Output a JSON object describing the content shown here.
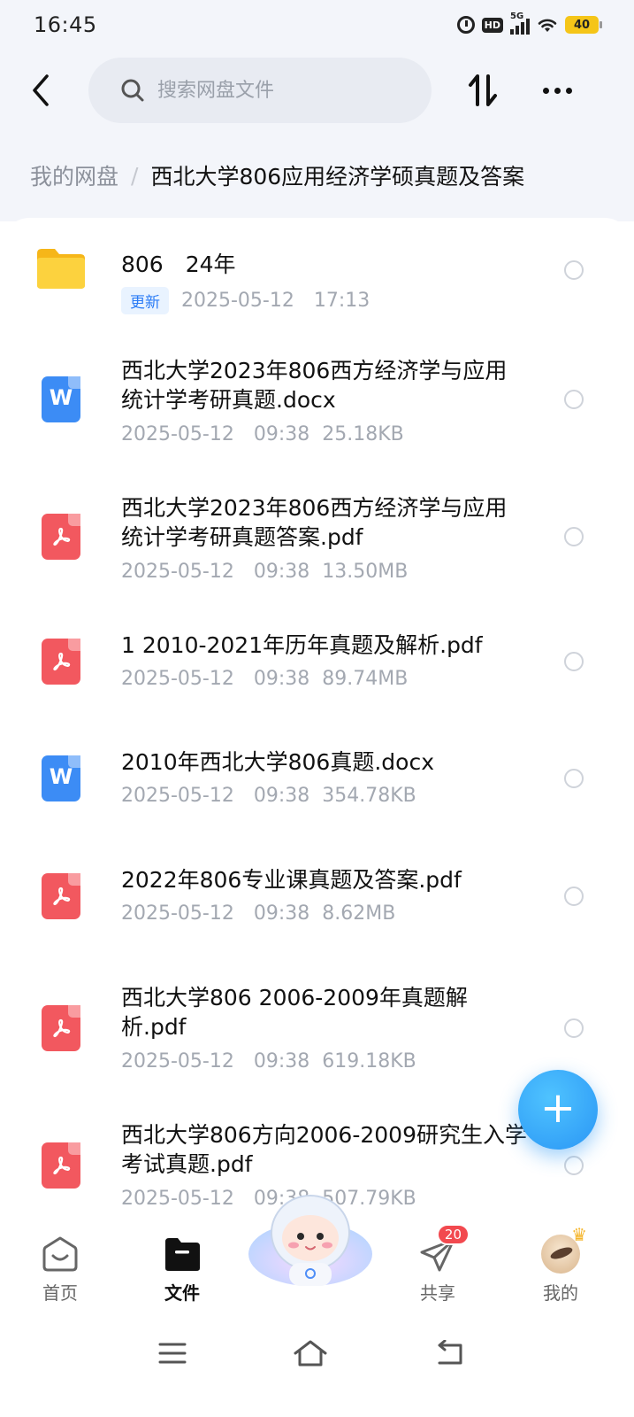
{
  "status_bar": {
    "time": "16:45",
    "network": "5G",
    "hd_label": "HD",
    "battery": "40"
  },
  "search": {
    "placeholder": "搜索网盘文件"
  },
  "breadcrumb": {
    "root": "我的网盘",
    "separator": "/",
    "current": "西北大学806应用经济学硕真题及答案"
  },
  "files": [
    {
      "type": "folder",
      "name": "806　24年",
      "badge": "更新",
      "date": "2025-05-12",
      "time": "17:13",
      "size": ""
    },
    {
      "type": "docx",
      "name": "西北大学2023年806西方经济学与应用统计学考研真题.docx",
      "date": "2025-05-12",
      "time": "09:38",
      "size": "25.18KB"
    },
    {
      "type": "pdf",
      "name": "西北大学2023年806西方经济学与应用统计学考研真题答案.pdf",
      "date": "2025-05-12",
      "time": "09:38",
      "size": "13.50MB"
    },
    {
      "type": "pdf",
      "name": "1  2010-2021年历年真题及解析.pdf",
      "date": "2025-05-12",
      "time": "09:38",
      "size": "89.74MB"
    },
    {
      "type": "docx",
      "name": "2010年西北大学806真题.docx",
      "date": "2025-05-12",
      "time": "09:38",
      "size": "354.78KB"
    },
    {
      "type": "pdf",
      "name": "2022年806专业课真题及答案.pdf",
      "date": "2025-05-12",
      "time": "09:38",
      "size": "8.62MB"
    },
    {
      "type": "pdf",
      "name": "西北大学806  2006-2009年真题解析.pdf",
      "date": "2025-05-12",
      "time": "09:38",
      "size": "619.18KB"
    },
    {
      "type": "pdf",
      "name": "西北大学806方向2006-2009研究生入学考试真题.pdf",
      "date": "2025-05-12",
      "time": "09:38",
      "size": "507.79KB"
    }
  ],
  "icons": {
    "word_glyph": "W",
    "fab_glyph": "+"
  },
  "bottom_nav": {
    "home": "首页",
    "files": "文件",
    "share": "共享",
    "share_badge": "20",
    "mine": "我的"
  },
  "colors": {
    "accent": "#2a96f5",
    "word": "#3c8cf5",
    "pdf": "#f2585f",
    "folder": "#fbc531"
  }
}
